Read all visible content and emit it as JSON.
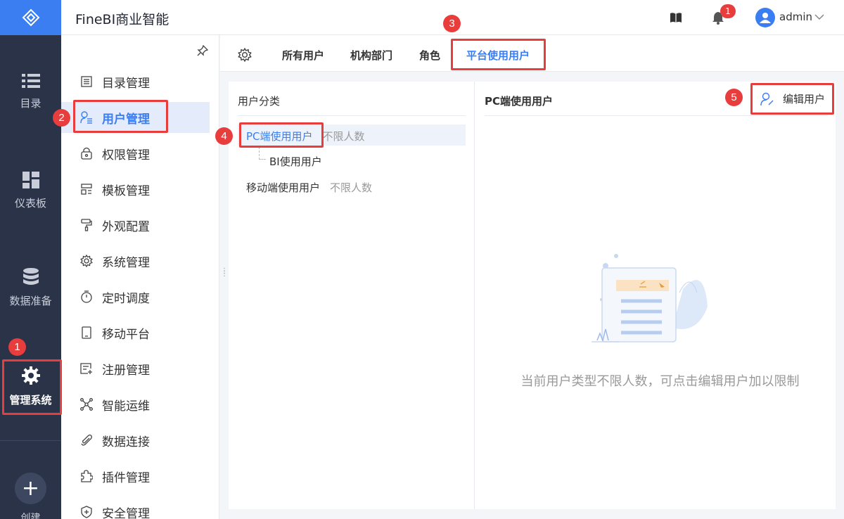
{
  "app": {
    "title": "FineBI商业智能"
  },
  "header": {
    "notifications_count": "1",
    "user_name": "admin"
  },
  "rail": {
    "items": [
      {
        "label": "目录",
        "icon": "list-icon"
      },
      {
        "label": "仪表板",
        "icon": "dashboard-icon"
      },
      {
        "label": "数据准备",
        "icon": "database-icon"
      },
      {
        "label": "管理系统",
        "icon": "gear-icon"
      }
    ],
    "create_label": "创建"
  },
  "sidebar": {
    "items": [
      {
        "label": "目录管理",
        "icon": "catalog-icon"
      },
      {
        "label": "用户管理",
        "icon": "user-manage-icon"
      },
      {
        "label": "权限管理",
        "icon": "lock-icon"
      },
      {
        "label": "模板管理",
        "icon": "template-icon"
      },
      {
        "label": "外观配置",
        "icon": "paint-roller-icon"
      },
      {
        "label": "系统管理",
        "icon": "gear-icon"
      },
      {
        "label": "定时调度",
        "icon": "timer-icon"
      },
      {
        "label": "移动平台",
        "icon": "mobile-icon"
      },
      {
        "label": "注册管理",
        "icon": "register-icon"
      },
      {
        "label": "智能运维",
        "icon": "network-icon"
      },
      {
        "label": "数据连接",
        "icon": "paperclip-icon"
      },
      {
        "label": "插件管理",
        "icon": "puzzle-icon"
      },
      {
        "label": "安全管理",
        "icon": "shield-icon"
      }
    ],
    "active_index": 1
  },
  "tabs": {
    "items": [
      "所有用户",
      "机构部门",
      "角色",
      "平台使用用户"
    ],
    "active_index": 3
  },
  "left_pane": {
    "title": "用户分类",
    "rows": [
      {
        "label": "PC端使用用户",
        "limit": "不限人数"
      },
      {
        "label": "BI使用用户",
        "limit": ""
      },
      {
        "label": "移动端使用用户",
        "limit": "不限人数"
      }
    ]
  },
  "right_pane": {
    "title": "PC端使用用户",
    "edit_button": "编辑用户",
    "empty_message": "当前用户类型不限人数，可点击编辑用户加以限制"
  },
  "callouts": [
    "1",
    "2",
    "3",
    "4",
    "5"
  ],
  "colors": {
    "accent": "#3a7ef2",
    "rail_bg": "#2a3348",
    "callout_red": "#e83d3d"
  }
}
